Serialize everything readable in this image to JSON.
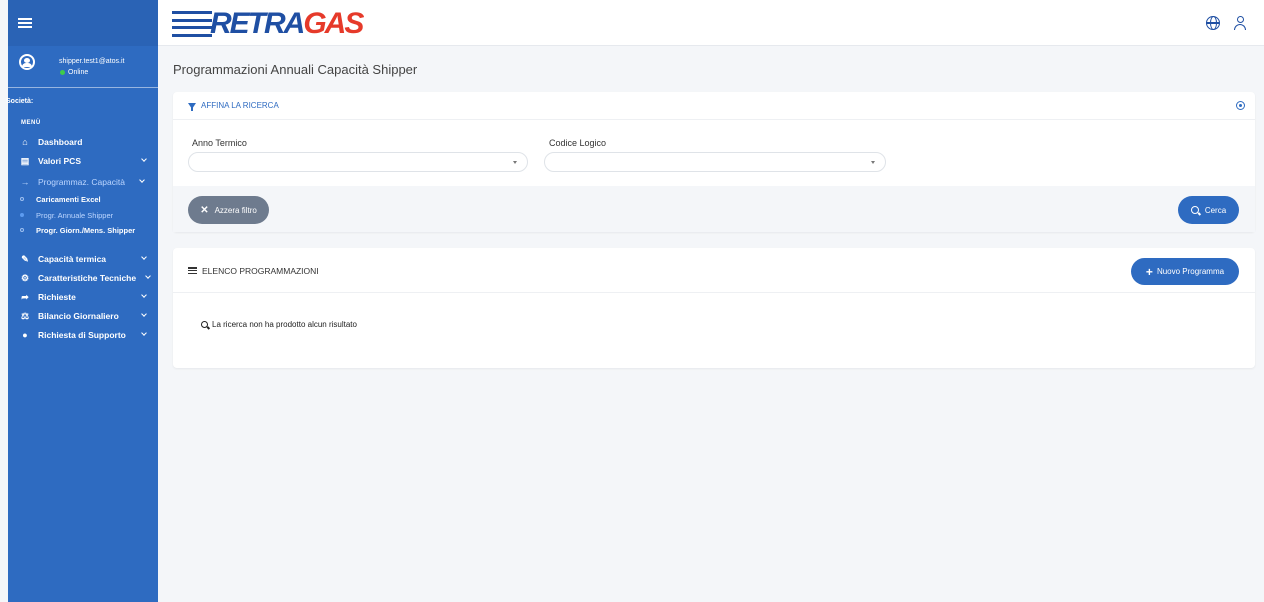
{
  "sidebar": {
    "user_email": "shipper.test1@atos.it",
    "user_status": "Online",
    "societa_label": "Società:",
    "menu_label": "MENÙ",
    "items": [
      {
        "label": "Dashboard",
        "icon": "home-icon"
      },
      {
        "label": "Valori PCS",
        "icon": "document-icon"
      },
      {
        "label": "Programmaz. Capacità",
        "icon": "sign-in-icon"
      },
      {
        "label": "Capacità termica",
        "icon": "pencil-icon"
      },
      {
        "label": "Caratteristiche Tecniche",
        "icon": "gears-icon"
      },
      {
        "label": "Richieste",
        "icon": "share-icon"
      },
      {
        "label": "Bilancio Giornaliero",
        "icon": "balance-icon"
      },
      {
        "label": "Richiesta di Supporto",
        "icon": "info-icon"
      }
    ],
    "sub_items": [
      {
        "label": "Caricamenti Excel"
      },
      {
        "label": "Progr. Annuale Shipper"
      },
      {
        "label": "Progr. Giorn./Mens. Shipper"
      }
    ]
  },
  "header": {
    "logo_part1": "RETRA",
    "logo_part2": "GAS"
  },
  "page": {
    "title": "Programmazioni Annuali Capacità Shipper"
  },
  "filter": {
    "title": "AFFINA LA RICERCA",
    "field1_label": "Anno Termico",
    "field2_label": "Codice Logico",
    "reset_label": "Azzera filtro",
    "search_label": "Cerca"
  },
  "list": {
    "title": "ELENCO PROGRAMMAZIONI",
    "new_label": "Nuovo Programma",
    "empty_message": "La ricerca non ha prodotto alcun risultato"
  },
  "colors": {
    "sidebar": "#2e6bc1",
    "accent": "#2e6bc1",
    "logo_red": "#e63a2a"
  }
}
